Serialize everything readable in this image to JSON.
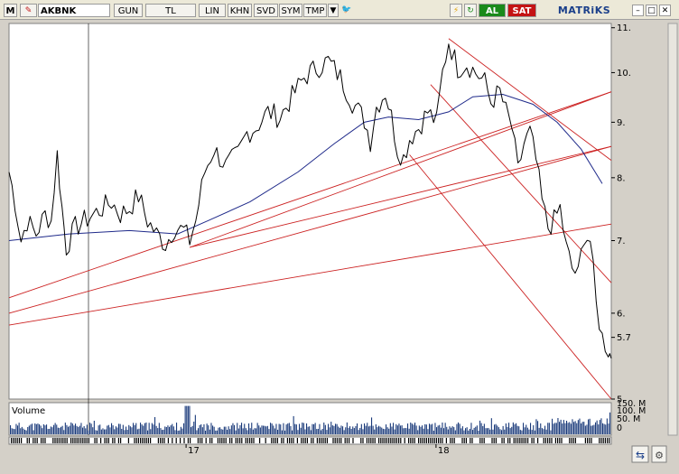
{
  "toolbar": {
    "menu_label": "M",
    "symbol": "AKBNK",
    "period": "GUN",
    "currency": "TL",
    "scale": "LIN",
    "khn": "KHN",
    "svd": "SVD",
    "sym": "SYM",
    "tmp": "TMP",
    "buy_label": "AL",
    "sell_label": "SAT",
    "brand": "MATRiKS",
    "colors": {
      "buy": "#1a8a1a",
      "sell": "#c41414",
      "price": "#000000",
      "ma": "#1f2a8a",
      "trend": "#cc2222",
      "volume": "#1a3a7a"
    }
  },
  "chart_data": {
    "type": "line",
    "y_scale": "log",
    "ylim": [
      5,
      11.1
    ],
    "y_ticks": [
      "11.",
      "10.",
      "9.",
      "8.",
      "7.",
      "6.",
      "5.7",
      "5"
    ],
    "y_tick_values": [
      11,
      10,
      9,
      8,
      7,
      6,
      5.7,
      5
    ],
    "x_tick_labels": [
      "17",
      "18"
    ],
    "x_tick_positions": [
      0.294,
      0.709
    ],
    "price_series": [
      [
        0.0,
        8.1
      ],
      [
        0.01,
        7.6
      ],
      [
        0.02,
        7.0
      ],
      [
        0.03,
        7.3
      ],
      [
        0.045,
        7.1
      ],
      [
        0.06,
        7.4
      ],
      [
        0.07,
        7.3
      ],
      [
        0.08,
        8.4
      ],
      [
        0.088,
        7.5
      ],
      [
        0.095,
        6.9
      ],
      [
        0.11,
        7.2
      ],
      [
        0.125,
        7.3
      ],
      [
        0.14,
        7.4
      ],
      [
        0.155,
        7.5
      ],
      [
        0.17,
        7.6
      ],
      [
        0.185,
        7.4
      ],
      [
        0.2,
        7.5
      ],
      [
        0.215,
        7.7
      ],
      [
        0.23,
        7.3
      ],
      [
        0.245,
        7.1
      ],
      [
        0.26,
        6.95
      ],
      [
        0.275,
        7.2
      ],
      [
        0.29,
        7.15
      ],
      [
        0.3,
        7.0
      ],
      [
        0.31,
        7.3
      ],
      [
        0.325,
        8.1
      ],
      [
        0.34,
        8.5
      ],
      [
        0.36,
        8.2
      ],
      [
        0.38,
        8.4
      ],
      [
        0.395,
        8.8
      ],
      [
        0.41,
        8.9
      ],
      [
        0.43,
        9.2
      ],
      [
        0.45,
        9.1
      ],
      [
        0.47,
        9.5
      ],
      [
        0.49,
        9.9
      ],
      [
        0.51,
        10.1
      ],
      [
        0.53,
        10.25
      ],
      [
        0.55,
        9.9
      ],
      [
        0.57,
        9.4
      ],
      [
        0.59,
        9.05
      ],
      [
        0.6,
        8.65
      ],
      [
        0.61,
        9.3
      ],
      [
        0.625,
        9.6
      ],
      [
        0.635,
        9.1
      ],
      [
        0.645,
        8.5
      ],
      [
        0.655,
        8.35
      ],
      [
        0.665,
        8.7
      ],
      [
        0.68,
        8.9
      ],
      [
        0.695,
        9.2
      ],
      [
        0.71,
        9.0
      ],
      [
        0.72,
        10.0
      ],
      [
        0.73,
        10.7
      ],
      [
        0.745,
        10.1
      ],
      [
        0.76,
        10.2
      ],
      [
        0.775,
        10.0
      ],
      [
        0.79,
        9.8
      ],
      [
        0.8,
        9.4
      ],
      [
        0.815,
        9.6
      ],
      [
        0.825,
        9.2
      ],
      [
        0.835,
        8.9
      ],
      [
        0.845,
        8.1
      ],
      [
        0.855,
        8.6
      ],
      [
        0.865,
        8.8
      ],
      [
        0.875,
        8.3
      ],
      [
        0.885,
        7.6
      ],
      [
        0.895,
        7.2
      ],
      [
        0.905,
        7.3
      ],
      [
        0.915,
        7.5
      ],
      [
        0.925,
        6.9
      ],
      [
        0.935,
        6.6
      ],
      [
        0.945,
        6.5
      ],
      [
        0.955,
        7.1
      ],
      [
        0.965,
        7.0
      ],
      [
        0.975,
        6.1
      ],
      [
        0.985,
        5.7
      ],
      [
        0.995,
        5.55
      ],
      [
        1.0,
        5.45
      ]
    ],
    "moving_average": [
      [
        0.0,
        7.0
      ],
      [
        0.1,
        7.1
      ],
      [
        0.2,
        7.15
      ],
      [
        0.28,
        7.1
      ],
      [
        0.33,
        7.3
      ],
      [
        0.4,
        7.6
      ],
      [
        0.48,
        8.1
      ],
      [
        0.54,
        8.6
      ],
      [
        0.59,
        9.0
      ],
      [
        0.63,
        9.1
      ],
      [
        0.68,
        9.05
      ],
      [
        0.73,
        9.2
      ],
      [
        0.77,
        9.5
      ],
      [
        0.82,
        9.55
      ],
      [
        0.87,
        9.35
      ],
      [
        0.91,
        9.0
      ],
      [
        0.95,
        8.5
      ],
      [
        0.985,
        7.9
      ]
    ],
    "trend_lines": [
      {
        "name": "channel-upper",
        "start": [
          0.73,
          10.75
        ],
        "end": [
          1.0,
          8.3
        ]
      },
      {
        "name": "channel-lower",
        "start": [
          0.665,
          8.4
        ],
        "end": [
          1.0,
          5.0
        ]
      },
      {
        "name": "channel-mid",
        "start": [
          0.7,
          9.75
        ],
        "end": [
          1.0,
          6.4
        ]
      },
      {
        "name": "fan-1",
        "start": [
          0.0,
          6.2
        ],
        "end": [
          1.0,
          9.6
        ]
      },
      {
        "name": "fan-2",
        "start": [
          0.0,
          6.0
        ],
        "end": [
          1.0,
          8.55
        ]
      },
      {
        "name": "fan-3",
        "start": [
          0.0,
          5.85
        ],
        "end": [
          1.0,
          7.25
        ]
      },
      {
        "name": "fan-4",
        "start": [
          0.3,
          6.9
        ],
        "end": [
          1.0,
          9.6
        ]
      },
      {
        "name": "fan-5",
        "start": [
          0.3,
          6.9
        ],
        "end": [
          1.0,
          8.55
        ]
      }
    ],
    "volume": {
      "label": "Volume",
      "y_ticks": [
        "150. M",
        "100. M",
        "50. M",
        "0"
      ],
      "y_tick_values": [
        150,
        100,
        50,
        0
      ]
    }
  }
}
